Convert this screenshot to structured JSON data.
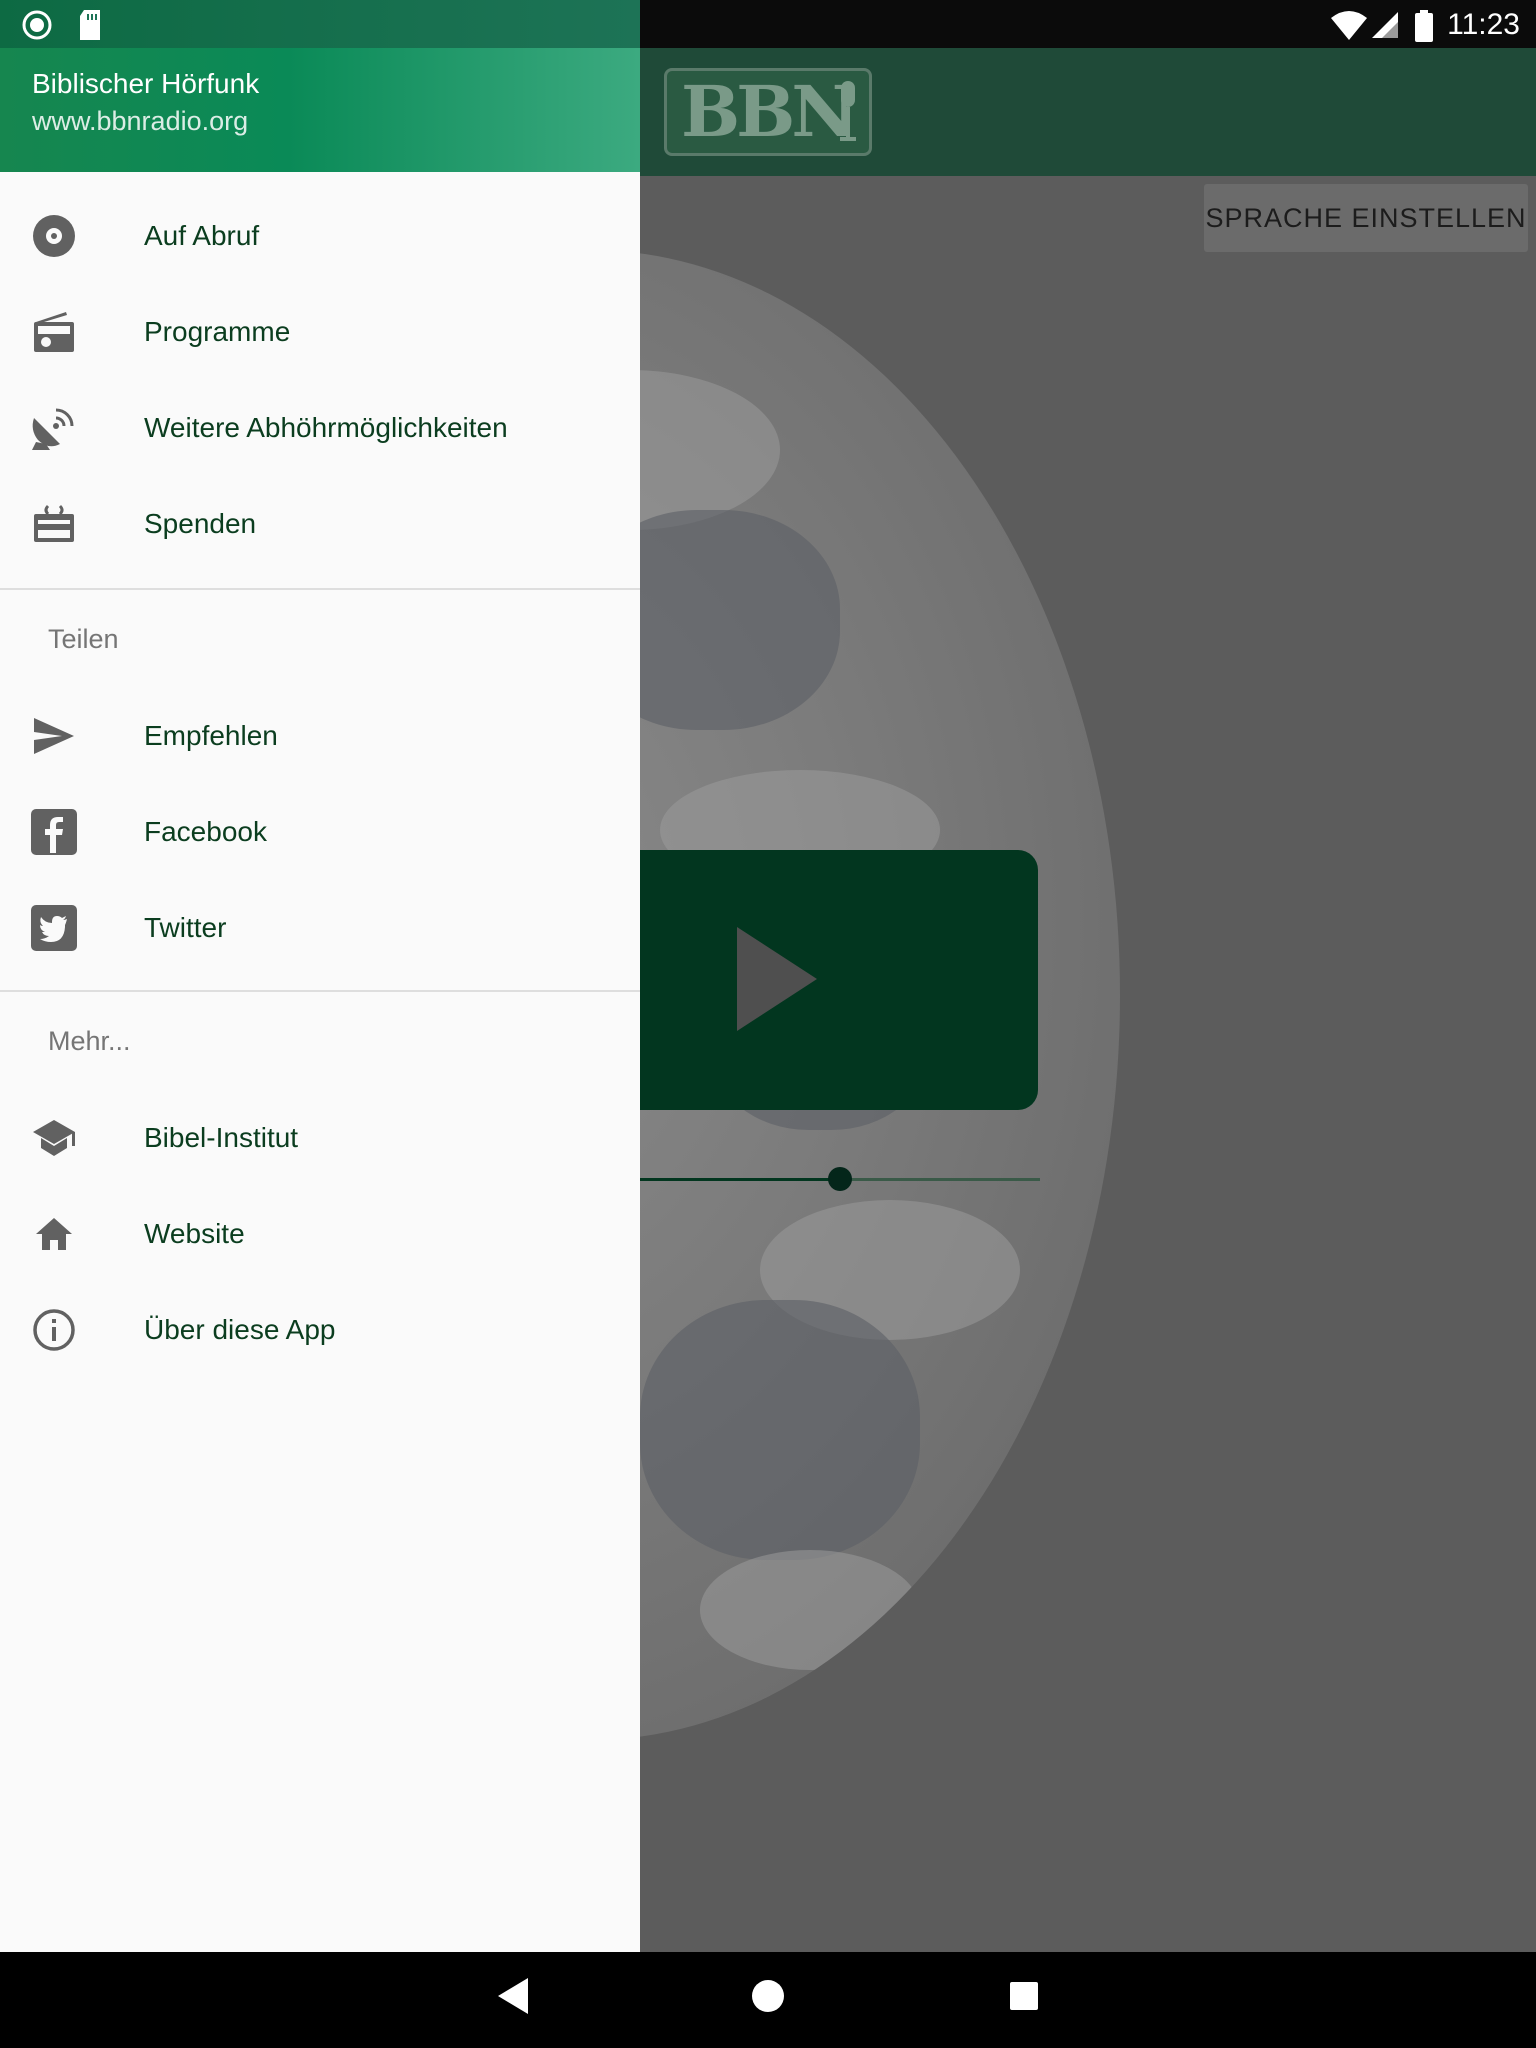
{
  "status_bar": {
    "time": "11:23",
    "icons": [
      "record-icon",
      "sd-card-icon",
      "wifi-icon",
      "signal-icon",
      "battery-icon"
    ]
  },
  "background_app": {
    "logo_text": "BBN",
    "language_button_label": "SPRACHE EINSTELLEN",
    "play_button_icon": "play-icon",
    "volume_level": 0.5
  },
  "drawer": {
    "header": {
      "title": "Biblischer Hörfunk",
      "subtitle": "www.bbnradio.org"
    },
    "main_items": [
      {
        "label": "Auf Abruf",
        "icon": "disc-icon"
      },
      {
        "label": "Programme",
        "icon": "radio-icon"
      },
      {
        "label": "Weitere Abhöhrmöglichkeiten",
        "icon": "satellite-dish-icon"
      },
      {
        "label": "Spenden",
        "icon": "gift-card-icon"
      }
    ],
    "share_section": {
      "title": "Teilen",
      "items": [
        {
          "label": "Empfehlen",
          "icon": "send-icon"
        },
        {
          "label": "Facebook",
          "icon": "facebook-icon"
        },
        {
          "label": "Twitter",
          "icon": "twitter-icon"
        }
      ]
    },
    "more_section": {
      "title": "Mehr...",
      "items": [
        {
          "label": "Bibel-Institut",
          "icon": "school-icon"
        },
        {
          "label": "Website",
          "icon": "home-icon"
        },
        {
          "label": "Über diese App",
          "icon": "info-icon"
        }
      ]
    }
  },
  "colors": {
    "drawer_header_start": "#16864f",
    "drawer_header_end": "#3caa80",
    "menu_text": "#0b3d1f",
    "icon_gray": "#616161",
    "play_button_bg": "#02361f"
  },
  "nav_bar": {
    "buttons": [
      "back-icon",
      "home-circle-icon",
      "recents-icon"
    ]
  }
}
